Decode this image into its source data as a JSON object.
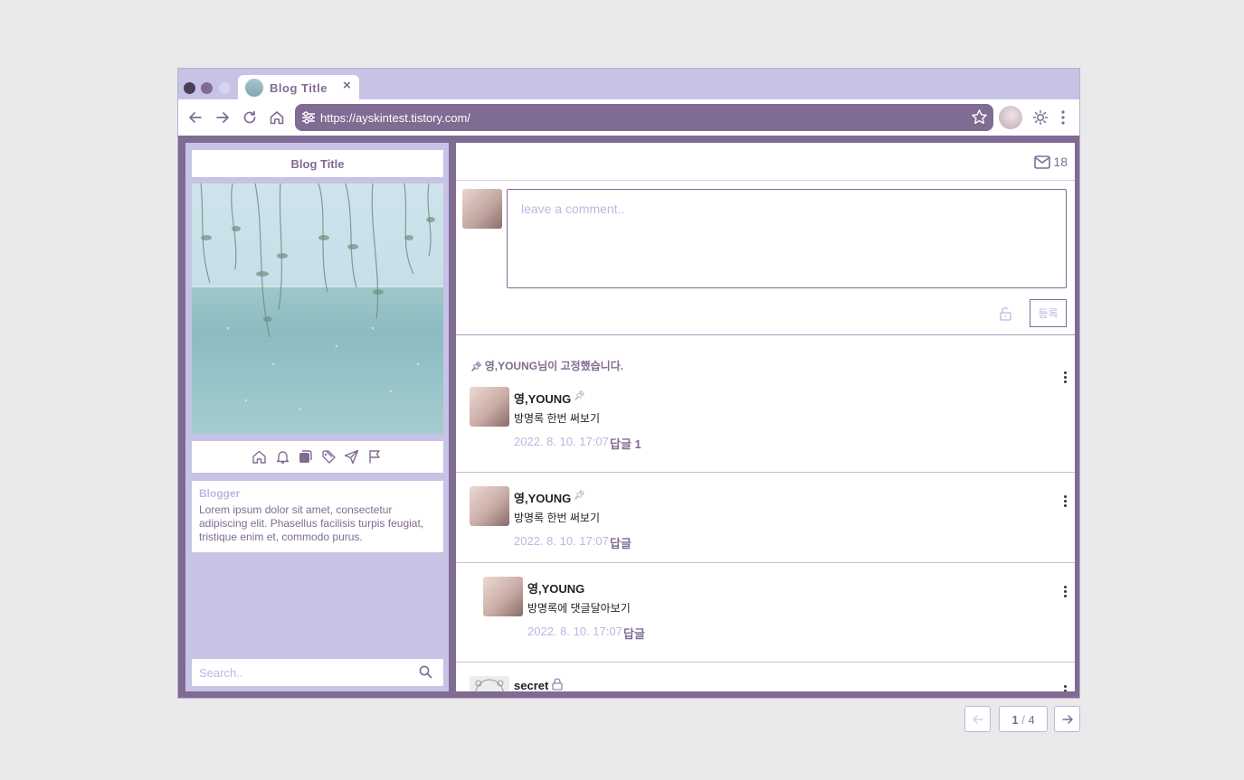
{
  "browser": {
    "tab_title": "Blog Title",
    "tab_close": "×",
    "url": "https://ayskintest.tistory.com/",
    "window_dots": [
      "#4a3f55",
      "#806b93",
      "#d9d2ec"
    ]
  },
  "sidebar": {
    "title": "Blog Title",
    "icons": [
      "home-icon",
      "bell-icon",
      "category-icon",
      "tag-icon",
      "send-icon",
      "flag-icon"
    ],
    "blogger_name": "Blogger",
    "blogger_desc": "Lorem ipsum dolor sit amet, consectetur adipiscing elit. Phasellus facilisis turpis feugiat, tristique enim et, commodo purus.",
    "search_placeholder": "Search.."
  },
  "main": {
    "message_count": "18",
    "comment_placeholder": "leave a comment..",
    "submit_label": "등록",
    "pinned_note": "영,YOUNG님이 고정했습니다.",
    "entries": [
      {
        "name": "영,YOUNG",
        "text": "방명록 한번 써보기",
        "date": "2022. 8. 10. 17:07",
        "reply": "답글 1"
      },
      {
        "name": "영,YOUNG",
        "text": "방명록 한번 써보기",
        "date": "2022. 8. 10. 17:07",
        "reply": "답글"
      },
      {
        "name": "영,YOUNG",
        "text": "방명록에 댓글달아보기",
        "date": "2022. 8. 10. 17:07",
        "reply": "답글"
      },
      {
        "name": "secret"
      }
    ]
  },
  "pagination": {
    "current": "1",
    "separator": "/",
    "total": "4"
  },
  "colors": {
    "accent": "#806b93",
    "lavender": "#c6c3e7",
    "muted": "#bdb6e3"
  }
}
